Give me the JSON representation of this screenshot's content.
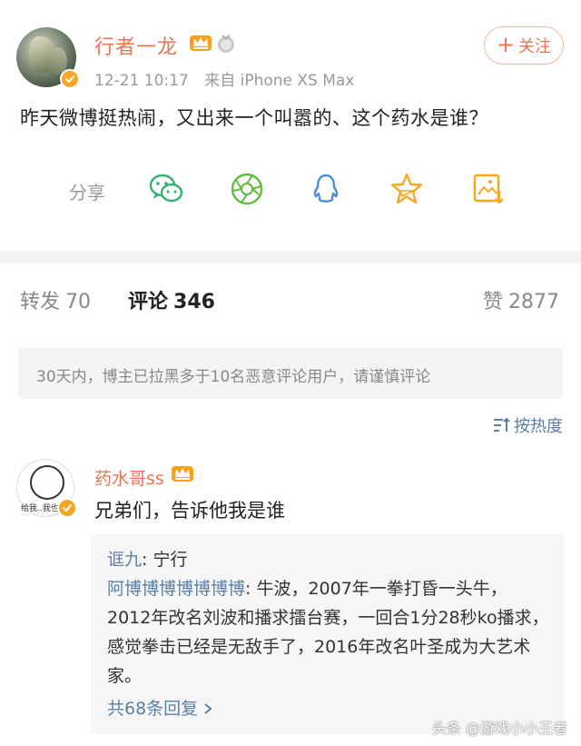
{
  "post": {
    "username": "行者一龙",
    "time": "12-21 10:17",
    "source": "来自 iPhone XS Max",
    "follow_label": "关注",
    "follow_plus": "+",
    "text": "昨天微博挺热闹，又出来一个叫嚣的、这个药水是谁？"
  },
  "share": {
    "label": "分享",
    "icons": [
      "wechat-icon",
      "moments-icon",
      "qq-icon",
      "qzone-star-icon",
      "save-image-icon"
    ]
  },
  "tabs": [
    {
      "label": "转发",
      "count": "70"
    },
    {
      "label": "评论",
      "count": "346"
    },
    {
      "label": "赞",
      "count": "2877"
    }
  ],
  "notice": "30天内，博主已拉黑多于10名恶意评论用户，请谨慎评论",
  "sort_label": "按热度",
  "comment": {
    "username": "药水哥ss",
    "text": "兄弟们，告诉他我是谁",
    "avatar_caption": "给我..我也",
    "replies": [
      {
        "author": "诓九",
        "text": ": 宁行"
      },
      {
        "author": "阿博博博博博博博",
        "text": ": 牛波，2007年一拳打昏一头牛，2012年改名刘波和播求擂台赛，一回合1分28秒ko播求，感觉拳击已经是无敌手了，2016年改名叶圣成为大艺术家。"
      }
    ],
    "more_replies": "共68条回复"
  },
  "watermark": "头条 @游戏小小王者",
  "colors": {
    "accent_orange": "#eb7350",
    "link_blue": "#5a7fa6",
    "verify_gold": "#f5a623",
    "share_green": "#33b26f",
    "share_blue": "#4a90d9",
    "share_gold": "#f5a623"
  }
}
